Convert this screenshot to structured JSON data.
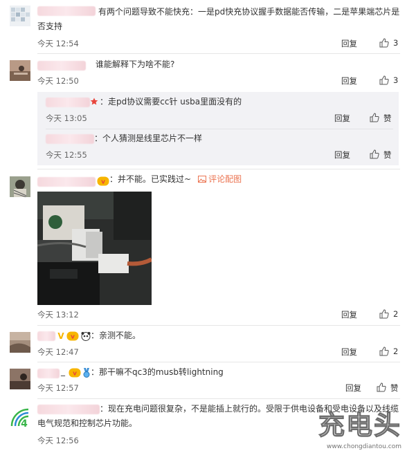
{
  "comments": [
    {
      "text": "有两个问题导致不能快充：一是pd快充协议握手数据能否传输，二是苹果端芯片是否支持",
      "time": "今天 12:54",
      "reply_label": "回复",
      "likes": "3"
    },
    {
      "text": "谁能解释下为啥不能?",
      "time": "今天 12:50",
      "reply_label": "回复",
      "likes": "3",
      "replies": [
        {
          "text": "走pd协议需要cc针 usba里面没有的",
          "time": "今天 13:05",
          "reply_label": "回复",
          "like_label": "赞"
        },
        {
          "text": "个人猜测是线里芯片不一样",
          "time": "今天 12:55",
          "reply_label": "回复",
          "like_label": "赞"
        }
      ]
    },
    {
      "text": "并不能。已实践过~",
      "pic_link": "评论配图",
      "time": "今天 13:12",
      "reply_label": "回复",
      "likes": "2"
    },
    {
      "text": "亲测不能。",
      "time": "今天 12:47",
      "reply_label": "回复",
      "likes": "2"
    },
    {
      "text": "那干嘛不qc3的musb转lightning",
      "time": "今天 12:57",
      "reply_label": "回复",
      "like_label": "赞"
    },
    {
      "text": "现在充电问题很复杂，不是能插上就行的。受限于供电设备和受电设备以及线缆电气规范和控制芯片功能。",
      "time": "今天 12:56"
    }
  ],
  "watermark": {
    "brand": "充电头",
    "url": "www.chongdiantou.com"
  },
  "colors": {
    "link": "#eb7350",
    "text": "#333333",
    "meta": "#666666",
    "sub_bg": "#f2f2f5"
  }
}
